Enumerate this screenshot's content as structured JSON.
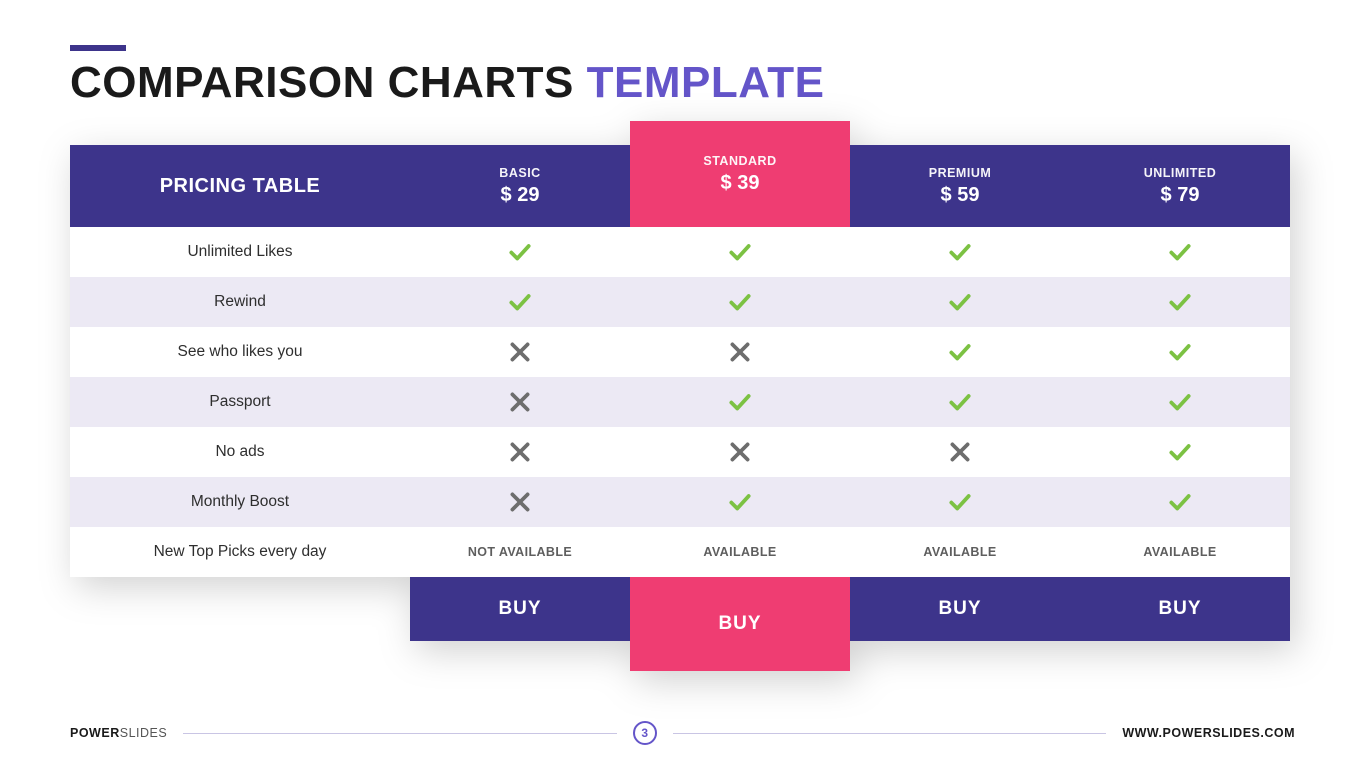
{
  "title": {
    "part1": "COMPARISON CHARTS ",
    "part2": "TEMPLATE"
  },
  "table": {
    "header_label": "PRICING TABLE",
    "plans": [
      {
        "name": "BASIC",
        "price": "$ 29",
        "featured": false,
        "buy": "BUY"
      },
      {
        "name": "STANDARD",
        "price": "$ 39",
        "featured": true,
        "buy": "BUY"
      },
      {
        "name": "PREMIUM",
        "price": "$ 59",
        "featured": false,
        "buy": "BUY"
      },
      {
        "name": "UNLIMITED",
        "price": "$ 79",
        "featured": false,
        "buy": "BUY"
      }
    ],
    "features": [
      "Unlimited Likes",
      "Rewind",
      "See who likes you",
      "Passport",
      "No ads",
      "Monthly Boost",
      "New Top Picks every day"
    ],
    "matrix": [
      [
        "check",
        "check",
        "check",
        "check"
      ],
      [
        "check",
        "check",
        "check",
        "check"
      ],
      [
        "cross",
        "cross",
        "check",
        "check"
      ],
      [
        "cross",
        "check",
        "check",
        "check"
      ],
      [
        "cross",
        "cross",
        "cross",
        "check"
      ],
      [
        "cross",
        "check",
        "check",
        "check"
      ],
      [
        "NOT AVAILABLE",
        "AVAILABLE",
        "AVAILABLE",
        "AVAILABLE"
      ]
    ]
  },
  "footer": {
    "brand1": "POWER",
    "brand2": "SLIDES",
    "page": "3",
    "url": "WWW.POWERSLIDES.COM"
  },
  "chart_data": {
    "type": "table",
    "title": "PRICING TABLE",
    "columns": [
      "Feature",
      "BASIC $29",
      "STANDARD $39",
      "PREMIUM $59",
      "UNLIMITED $79"
    ],
    "rows": [
      [
        "Unlimited Likes",
        true,
        true,
        true,
        true
      ],
      [
        "Rewind",
        true,
        true,
        true,
        true
      ],
      [
        "See who likes you",
        false,
        false,
        true,
        true
      ],
      [
        "Passport",
        false,
        true,
        true,
        true
      ],
      [
        "No ads",
        false,
        false,
        false,
        true
      ],
      [
        "Monthly Boost",
        false,
        true,
        true,
        true
      ],
      [
        "New Top Picks every day",
        "NOT AVAILABLE",
        "AVAILABLE",
        "AVAILABLE",
        "AVAILABLE"
      ]
    ]
  }
}
